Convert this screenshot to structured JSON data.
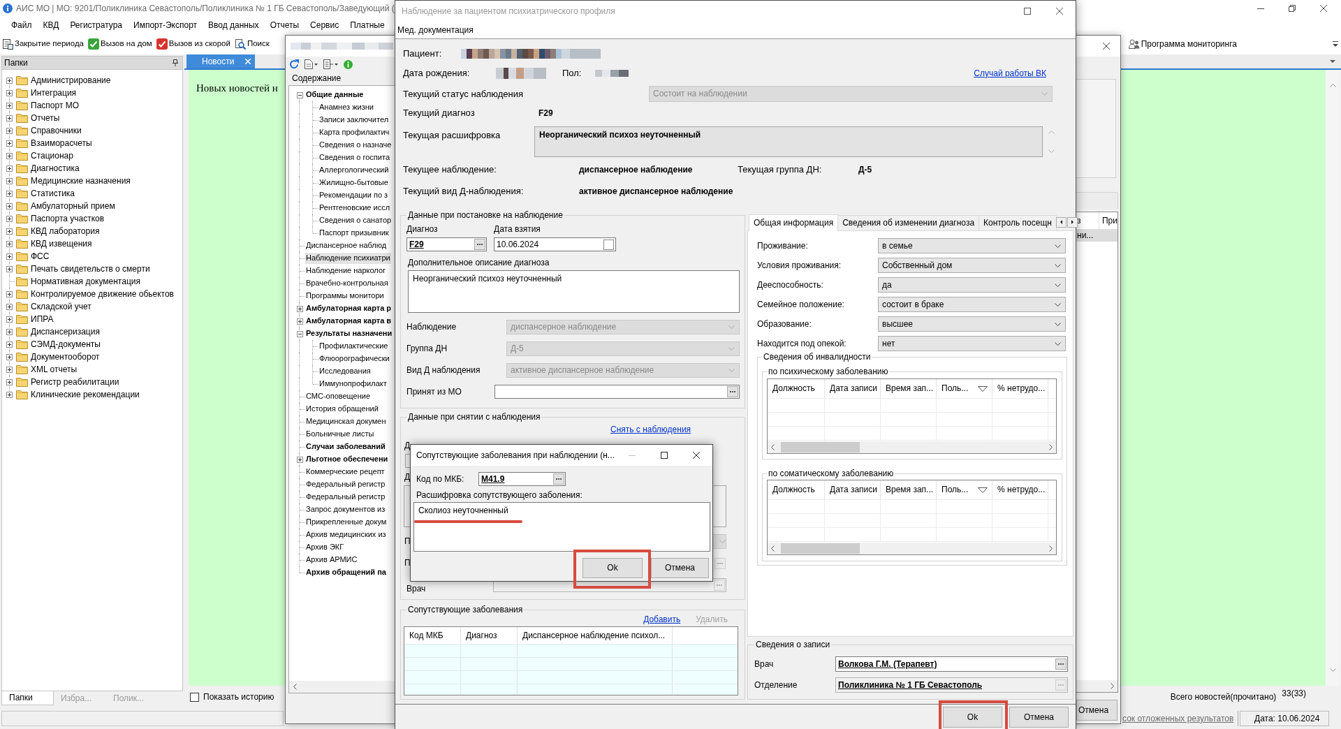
{
  "app": {
    "title": "АИС МО | МО: 9201/Поликлиника Севастополь/Поликлиника № 1 ГБ Севастополь/Заведующий (",
    "menu": [
      "Файл",
      "КВД",
      "Регистратура",
      "Импорт-Экспорт",
      "Ввод данных",
      "Отчеты",
      "Сервис",
      "Платные"
    ],
    "toolbar": [
      "Закрытие периода",
      "Вызов на дом",
      "Вызов из скорой",
      "Поиск"
    ],
    "monitoring": "Программа мониторинга",
    "folders": {
      "title": "Папки",
      "items": [
        {
          "label": "Администрирование",
          "expanded": false
        },
        {
          "label": "Интеграция",
          "expanded": false
        },
        {
          "label": "Паспорт МО",
          "expanded": false
        },
        {
          "label": "Отчеты",
          "expanded": false
        },
        {
          "label": "Справочники",
          "expanded": false
        },
        {
          "label": "Взаиморасчеты",
          "expanded": false
        },
        {
          "label": "Стационар",
          "expanded": false
        },
        {
          "label": "Диагностика",
          "expanded": false
        },
        {
          "label": "Медицинские назначения",
          "expanded": false
        },
        {
          "label": "Статистика",
          "expanded": false
        },
        {
          "label": "Амбулаторный прием",
          "expanded": false
        },
        {
          "label": "Паспорта участков",
          "expanded": false
        },
        {
          "label": "КВД лаборатория",
          "expanded": false
        },
        {
          "label": "КВД извещения",
          "expanded": false
        },
        {
          "label": "ФСС",
          "expanded": false
        },
        {
          "label": "Печать свидетельств о смерти",
          "expanded": false
        },
        {
          "label": "Нормативная документация"
        },
        {
          "label": "Контролируемое движение обьектов",
          "expanded": false
        },
        {
          "label": "Складской учет",
          "expanded": false
        },
        {
          "label": "ИПРА",
          "expanded": false
        },
        {
          "label": "Диспансеризация",
          "expanded": false
        },
        {
          "label": "СЭМД-документы",
          "expanded": false
        },
        {
          "label": "Документооборот",
          "expanded": false
        },
        {
          "label": "XML отчеты",
          "expanded": false
        },
        {
          "label": "Регистр реабилитации",
          "expanded": false
        },
        {
          "label": "Клинические рекомендации",
          "expanded": false
        }
      ],
      "tabs": [
        {
          "label": "Папки",
          "selected": true
        },
        {
          "label": "Избра...",
          "selected": false
        },
        {
          "label": "Полик...",
          "selected": false
        }
      ]
    },
    "news": {
      "tab": "Новости",
      "text": "Новых новостей н",
      "show_history": {
        "label": "Показать историю",
        "checked": false
      },
      "total_label": "Всего новостей(прочитано)",
      "total_count": "33(33)"
    },
    "status_bar": {
      "link": "сок отложенных результатов",
      "date": "Дата: 10.06.2024"
    }
  },
  "contents_window": {
    "header": "Содержание",
    "tree": [
      {
        "label": "Общие данные",
        "bold": true,
        "selected": false,
        "expanded": true,
        "children": [
          {
            "label": "Анамнез жизни",
            "bold": false,
            "selected": false
          },
          {
            "label": "Записи заключител",
            "bold": false,
            "selected": false
          },
          {
            "label": "Карта профилактич",
            "bold": false,
            "selected": false
          },
          {
            "label": "Сведения о назначе",
            "bold": false,
            "selected": false
          },
          {
            "label": "Сведения о госпита",
            "bold": false,
            "selected": false
          },
          {
            "label": "Аллергологический",
            "bold": false,
            "selected": false
          },
          {
            "label": "Жилищно-бытовые",
            "bold": false,
            "selected": false
          },
          {
            "label": "Рекомендации по з",
            "bold": false,
            "selected": false
          },
          {
            "label": "Рентгеновские иссл",
            "bold": false,
            "selected": false
          },
          {
            "label": "Сведения о санатор",
            "bold": false,
            "selected": false
          },
          {
            "label": "Паспорт призывник",
            "bold": false,
            "selected": false
          }
        ]
      },
      {
        "label": "Диспансерное наблюд",
        "bold": false,
        "selected": false
      },
      {
        "label": "Наблюдение психиатри",
        "bold": false,
        "selected": true
      },
      {
        "label": "Наблюдение нарколог",
        "bold": false,
        "selected": false
      },
      {
        "label": "Врачебно-контрольная",
        "bold": false,
        "selected": false
      },
      {
        "label": "Программы монитори",
        "bold": false,
        "selected": false
      },
      {
        "label": "Амбулаторная карта р",
        "bold": true,
        "selected": false,
        "expanded": false
      },
      {
        "label": "Амбулаторная карта в",
        "bold": true,
        "selected": false,
        "expanded": false
      },
      {
        "label": "Результаты назначени",
        "bold": true,
        "selected": false,
        "expanded": true,
        "children": [
          {
            "label": "Профилактические",
            "bold": false,
            "selected": false
          },
          {
            "label": "Флюорографически",
            "bold": false,
            "selected": false
          },
          {
            "label": "Исследования",
            "bold": false,
            "selected": false
          },
          {
            "label": "Иммунопрофилакт",
            "bold": false,
            "selected": false
          }
        ]
      },
      {
        "label": "СМС-оповещение",
        "bold": false,
        "selected": false
      },
      {
        "label": "История обращений",
        "bold": false,
        "selected": false
      },
      {
        "label": "Медицинская докумен",
        "bold": false,
        "selected": false
      },
      {
        "label": "Больничные листы",
        "bold": false,
        "selected": false
      },
      {
        "label": "Случаи заболеваний",
        "bold": true,
        "selected": false
      },
      {
        "label": "Льготное обеспечени",
        "bold": true,
        "selected": false,
        "expanded": false
      },
      {
        "label": "Коммерческие рецепт",
        "bold": false,
        "selected": false
      },
      {
        "label": "Федеральный регистр",
        "bold": false,
        "selected": false
      },
      {
        "label": "Федеральный регистр",
        "bold": false,
        "selected": false
      },
      {
        "label": "Запрос документов из",
        "bold": false,
        "selected": false
      },
      {
        "label": "Прикрепленные докум",
        "bold": false,
        "selected": false
      },
      {
        "label": "Архив медицинских из",
        "bold": false,
        "selected": false
      },
      {
        "label": "Архив ЭКГ",
        "bold": false,
        "selected": false
      },
      {
        "label": "Архив АРМИС",
        "bold": false,
        "selected": false
      },
      {
        "label": "Архив обращений па",
        "bold": true,
        "selected": false
      }
    ],
    "table": {
      "columns": [
        "з",
        "При"
      ],
      "rows": [
        {
          "cells": [
            "ни..."
          ],
          "selected": true
        }
      ]
    },
    "cancel_button": "Отмена"
  },
  "dialog": {
    "title": "Наблюдение за пациентом психиатрического профиля",
    "menu": [
      "Мед. документация"
    ],
    "patient_label": "Пациент:",
    "birth_label": "Дата рождения:",
    "sex_label": "Пол:",
    "vk_link": "Случай работы ВК",
    "status": {
      "label": "Текущий статус наблюдения",
      "value": "Состоит на наблюдении",
      "disabled": true
    },
    "current_diagnosis": {
      "label": "Текущий диагноз",
      "value": "F29"
    },
    "current_decoding": {
      "label": "Текущая расшифровка",
      "value": "Неорганический психоз неуточненный"
    },
    "current_observation": {
      "label": "Текущее наблюдение:",
      "value": "диспансерное наблюдение"
    },
    "current_group": {
      "label": "Текущая группа ДН:",
      "value": "Д-5"
    },
    "current_type": {
      "label": "Текущий вид Д-наблюдения:",
      "value": "активное диспансерное наблюдение"
    },
    "registration": {
      "title": "Данные при постановке на наблюдение",
      "diagnosis_label": "Диагноз",
      "diagnosis": "F29",
      "date_label": "Дата взятия",
      "date": "10.06.2024",
      "description_label": "Дополнительное описание диагноза",
      "description": "Неорганический психоз неуточненный",
      "fields": [
        {
          "kind": "combo",
          "label": "Наблюдение",
          "value": "диспансерное наблюдение",
          "disabled": true
        },
        {
          "kind": "combo",
          "label": "Группа ДН",
          "value": "Д-5",
          "disabled": true
        },
        {
          "kind": "combo",
          "label": "Вид Д наблюдения",
          "value": "активное диспансерное наблюдение",
          "disabled": true
        },
        {
          "kind": "lookup",
          "label": "Принят из МО",
          "disabled": false
        }
      ]
    },
    "removal": {
      "title": "Данные при снятии с наблюдения",
      "link": "Снять с наблюдения",
      "rows": [
        {
          "kind": "date",
          "label": "Д"
        },
        {
          "kind": "memo",
          "label": "Д"
        },
        {
          "kind": "combo",
          "label": "П"
        },
        {
          "kind": "lookup",
          "label": "П"
        },
        {
          "kind": "doctor",
          "label": "Врач"
        }
      ]
    },
    "comorbid": {
      "title": "Сопутствующие заболевания",
      "add_link": "Добавить",
      "remove_link": {
        "label": "Удалить",
        "disabled": true
      },
      "columns": [
        "Код МКБ",
        "Диагноз",
        "Диспансерное наблюдение психол..."
      ]
    },
    "tabs": [
      {
        "label": "Общая информация",
        "selected": true
      },
      {
        "label": "Сведения об изменении диагноза",
        "selected": false
      },
      {
        "label": "Контроль посещн",
        "selected": false
      }
    ],
    "social": [
      {
        "label": "Проживание:",
        "value": "в семье"
      },
      {
        "label": "Условия проживания:",
        "value": "Собственный дом"
      },
      {
        "label": "Дееспособность:",
        "value": "да"
      },
      {
        "label": "Семейное положение:",
        "value": "состоит в браке"
      },
      {
        "label": "Образование:",
        "value": "высшее"
      },
      {
        "label": "Находится под опекой:",
        "value": "нет"
      }
    ],
    "disability": {
      "title": "Сведения об инвалидности",
      "sections": [
        {
          "title": "по психическому заболеванию",
          "columns": [
            {
              "label": "Должность",
              "filter": false
            },
            {
              "label": "Дата записи",
              "filter": false
            },
            {
              "label": "Время зап...",
              "filter": false
            },
            {
              "label": "Поль...",
              "filter": true
            },
            {
              "label": "% нетрудо...",
              "filter": false
            }
          ]
        },
        {
          "title": "по соматическому заболеванию",
          "columns": [
            {
              "label": "Должность",
              "filter": false
            },
            {
              "label": "Дата записи",
              "filter": false
            },
            {
              "label": "Время зап...",
              "filter": false
            },
            {
              "label": "Поль...",
              "filter": true
            },
            {
              "label": "% нетрудо...",
              "filter": false
            }
          ]
        }
      ]
    },
    "record": {
      "title": "Сведения о записи",
      "doctor_label": "Врач",
      "doctor": "Волкова Г.М. (Терапевт)",
      "department_label": "Отделение",
      "department": "Поликлиника № 1 ГБ Севастополь"
    },
    "buttons": [
      {
        "label": "Ok",
        "marked": true
      },
      {
        "label": "Отмена",
        "marked": false
      }
    ]
  },
  "sub_dialog": {
    "title": "Сопутствующие заболевания при наблюдении (н...",
    "code_label": "Код по МКБ:",
    "code": "M41.9",
    "decoding_label": "Расшифровка сопутствующего заболения:",
    "decoding": "Сколиоз неуточненный",
    "decoding_marked": true,
    "buttons": [
      {
        "label": "Ok",
        "marked": true
      },
      {
        "label": "Отмена",
        "marked": false
      }
    ]
  }
}
